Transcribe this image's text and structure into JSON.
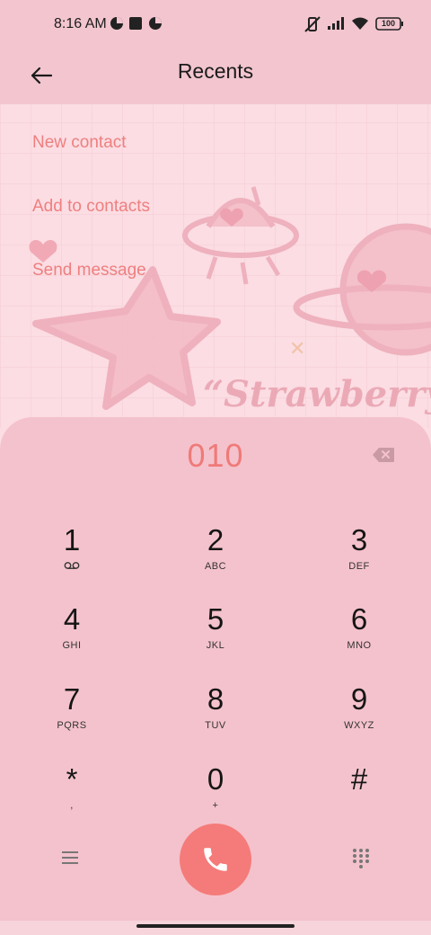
{
  "status_bar": {
    "time": "8:16 AM",
    "battery": "100",
    "icons": [
      "data-saver-icon",
      "square-notification-icon",
      "data-saver-icon",
      "vibrate-off-icon",
      "signal-icon",
      "wifi-icon",
      "battery-icon"
    ]
  },
  "header": {
    "title": "Recents",
    "back_icon": "back-arrow-icon"
  },
  "actions": {
    "new_contact": "New contact",
    "add_to_contacts": "Add to contacts",
    "send_message": "Send message"
  },
  "wallpaper": {
    "text": "“Strawberry”"
  },
  "dialer": {
    "number": "010",
    "keys": [
      {
        "digit": "1",
        "letters": ""
      },
      {
        "digit": "2",
        "letters": "ABC"
      },
      {
        "digit": "3",
        "letters": "DEF"
      },
      {
        "digit": "4",
        "letters": "GHI"
      },
      {
        "digit": "5",
        "letters": "JKL"
      },
      {
        "digit": "6",
        "letters": "MNO"
      },
      {
        "digit": "7",
        "letters": "PQRS"
      },
      {
        "digit": "8",
        "letters": "TUV"
      },
      {
        "digit": "9",
        "letters": "WXYZ"
      },
      {
        "digit": "*",
        "letters": ","
      },
      {
        "digit": "0",
        "letters": "+"
      },
      {
        "digit": "#",
        "letters": ""
      }
    ],
    "icons": {
      "menu": "menu-icon",
      "call": "phone-icon",
      "keypad": "keypad-icon",
      "backspace": "backspace-icon",
      "voicemail": "voicemail-icon"
    }
  },
  "colors": {
    "accent": "#ef7f7f",
    "call_button": "#f47b79",
    "panel": "#f4c2cc",
    "header": "#f2c5cf"
  }
}
